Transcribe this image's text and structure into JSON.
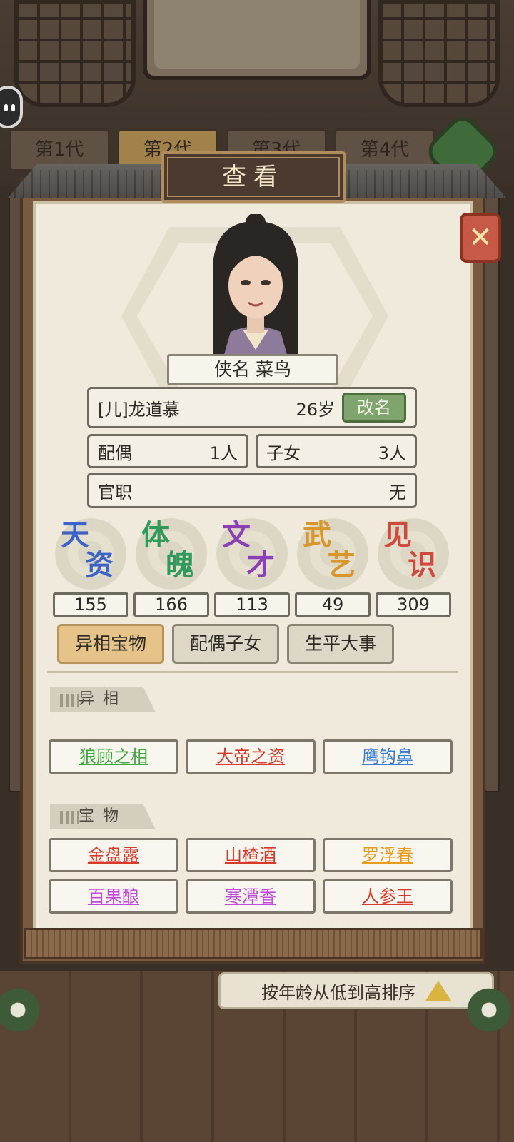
{
  "background": {
    "generation_tabs": [
      "第1代",
      "第2代",
      "第3代",
      "第4代"
    ],
    "active_tab_index": 1,
    "sort_label": "按年龄从低到高排序"
  },
  "dialog": {
    "title": "查看",
    "close_icon": "close-icon",
    "nickname": "侠名 菜鸟",
    "name": "[儿]龙道慕",
    "age": "26岁",
    "rename_label": "改名",
    "spouse_label": "配偶",
    "spouse_value": "1人",
    "children_label": "子女",
    "children_value": "3人",
    "office_label": "官职",
    "office_value": "无"
  },
  "stats": [
    {
      "label": "天资",
      "c1": "天",
      "c2": "资",
      "value": "155",
      "color": "#3e63c8"
    },
    {
      "label": "体魄",
      "c1": "体",
      "c2": "魄",
      "value": "166",
      "color": "#2f9a5a"
    },
    {
      "label": "文才",
      "c1": "文",
      "c2": "才",
      "value": "113",
      "color": "#8a3fb6"
    },
    {
      "label": "武艺",
      "c1": "武",
      "c2": "艺",
      "value": "49",
      "color": "#d9962a"
    },
    {
      "label": "见识",
      "c1": "见",
      "c2": "识",
      "value": "309",
      "color": "#cf4a3c"
    }
  ],
  "tabs": [
    "异相宝物",
    "配偶子女",
    "生平大事"
  ],
  "active_content_tab": 0,
  "traits_section": {
    "title": "异相",
    "items": [
      {
        "label": "狼顾之相",
        "color": "#3aa83a"
      },
      {
        "label": "大帝之资",
        "color": "#d83a2a"
      },
      {
        "label": "鹰钩鼻",
        "color": "#3a7dd8"
      }
    ]
  },
  "treasures_section": {
    "title": "宝物",
    "items": [
      {
        "label": "金盘露",
        "color": "#d83a2a"
      },
      {
        "label": "山楂酒",
        "color": "#d83a2a"
      },
      {
        "label": "罗浮春",
        "color": "#e89a1a"
      },
      {
        "label": "百果酿",
        "color": "#c04ad8"
      },
      {
        "label": "寒潭香",
        "color": "#c04ad8"
      },
      {
        "label": "人参王",
        "color": "#d83a2a"
      }
    ]
  }
}
